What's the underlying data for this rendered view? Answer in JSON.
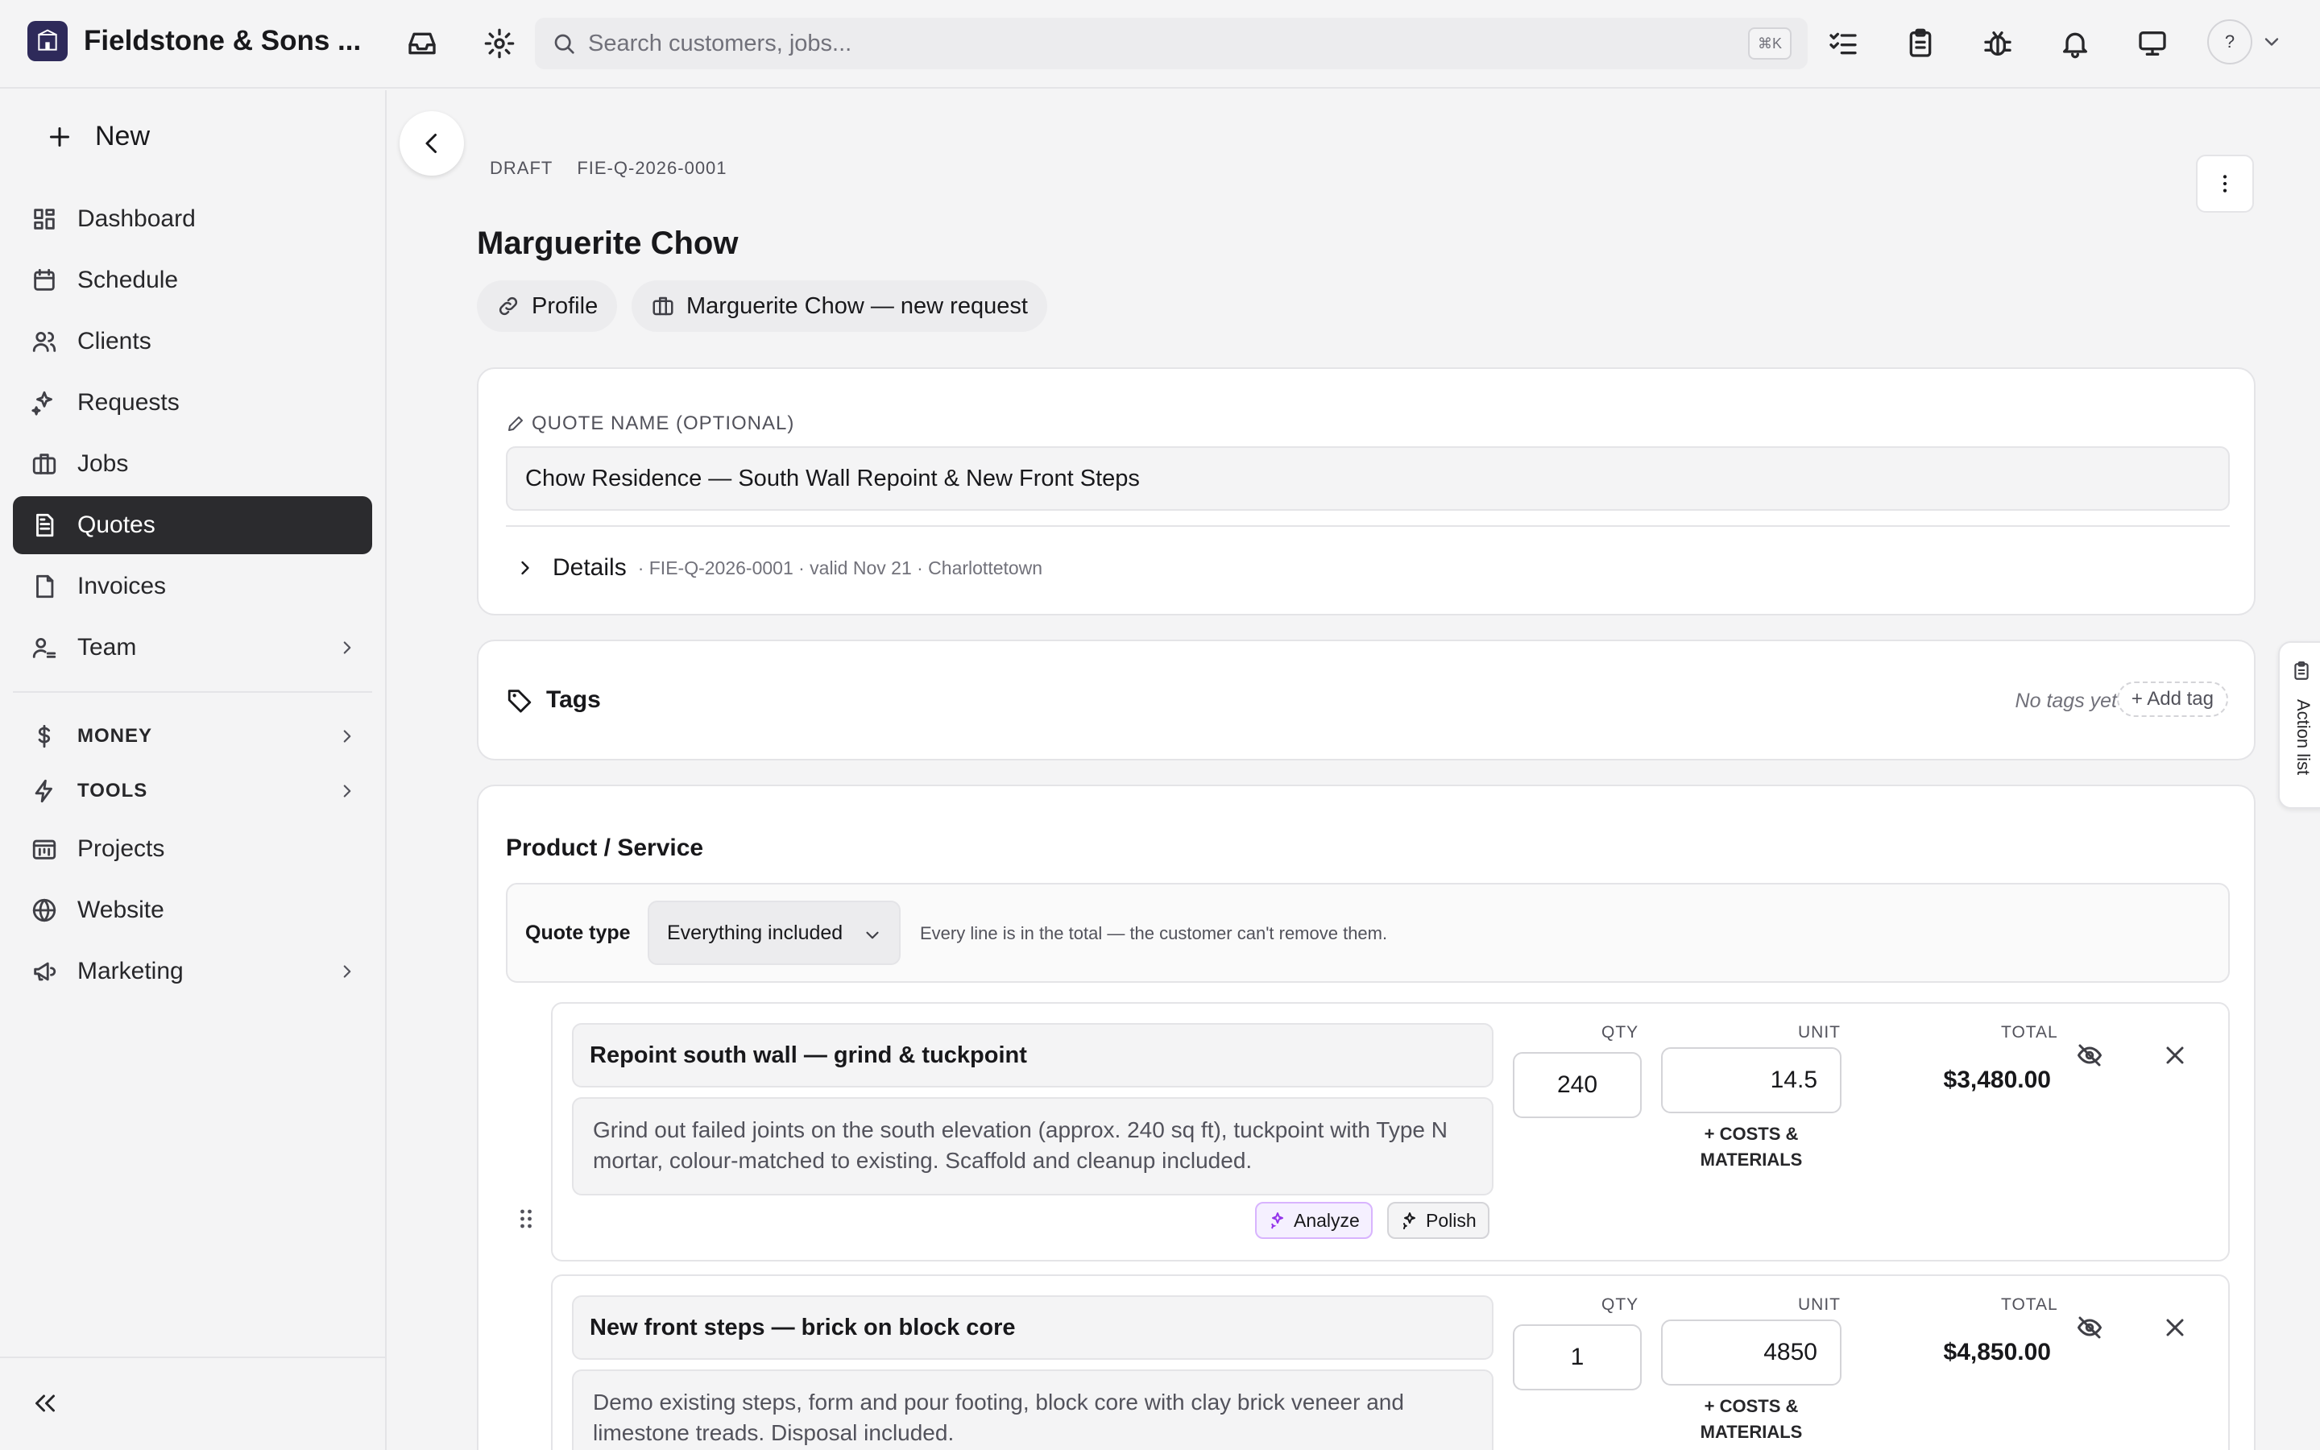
{
  "app": {
    "company_name": "Fieldstone & Sons ...",
    "search_placeholder": "Search customers, jobs...",
    "search_shortcut": "⌘K",
    "help_label": "?"
  },
  "sidebar": {
    "new_label": "New",
    "items": [
      {
        "label": "Dashboard",
        "icon": "dashboard-icon"
      },
      {
        "label": "Schedule",
        "icon": "calendar-icon"
      },
      {
        "label": "Clients",
        "icon": "users-icon"
      },
      {
        "label": "Requests",
        "icon": "sparkles-icon"
      },
      {
        "label": "Jobs",
        "icon": "briefcase-icon"
      },
      {
        "label": "Quotes",
        "icon": "document-icon",
        "active": true
      },
      {
        "label": "Invoices",
        "icon": "invoice-icon"
      },
      {
        "label": "Team",
        "icon": "team-icon"
      }
    ],
    "sections": [
      {
        "label": "MONEY",
        "icon": "dollar-icon"
      },
      {
        "label": "TOOLS",
        "icon": "bolt-icon"
      }
    ],
    "extra_items": [
      {
        "label": "Projects",
        "icon": "projects-icon"
      },
      {
        "label": "Website",
        "icon": "globe-icon"
      },
      {
        "label": "Marketing",
        "icon": "megaphone-icon"
      }
    ]
  },
  "quote": {
    "status": "DRAFT",
    "number": "FIE-Q-2026-0001",
    "client_name": "Marguerite Chow",
    "chips": {
      "profile": "Profile",
      "request": "Marguerite Chow — new request"
    },
    "name_label": "QUOTE NAME (OPTIONAL)",
    "name_value": "Chow Residence — South Wall Repoint & New Front Steps",
    "details_label": "Details",
    "details_meta": "· FIE-Q-2026-0001 · valid Nov 21 · Charlottetown"
  },
  "tags": {
    "title": "Tags",
    "empty_text": "No tags yet",
    "add_label": "+ Add tag"
  },
  "products": {
    "title": "Product / Service",
    "quote_type_label": "Quote type",
    "quote_type_value": "Everything included",
    "quote_type_help": "Every line is in the total — the customer can't remove them.",
    "col_qty": "QTY",
    "col_unit": "UNIT",
    "col_total": "TOTAL",
    "costs_label": "+ COSTS & MATERIALS",
    "analyze_label": "Analyze",
    "polish_label": "Polish",
    "line_items": [
      {
        "name": "Repoint south wall — grind & tuckpoint",
        "description": "Grind out failed joints on the south elevation (approx. 240 sq ft), tuckpoint with Type N mortar, colour-matched to existing. Scaffold and cleanup included.",
        "qty": "240",
        "unit": "14.5",
        "total": "$3,480.00"
      },
      {
        "name": "New front steps — brick on block core",
        "description": "Demo existing steps, form and pour footing, block core with clay brick veneer and limestone treads. Disposal included.",
        "qty": "1",
        "unit": "4850",
        "total": "$4,850.00"
      }
    ]
  },
  "action_list": {
    "label": "Action list"
  }
}
